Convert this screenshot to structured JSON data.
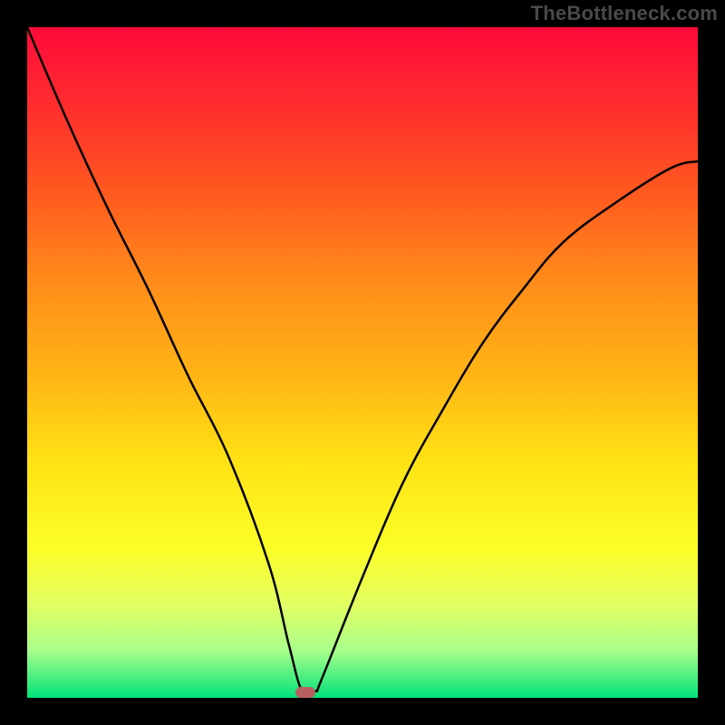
{
  "watermark": "TheBottleneck.com",
  "chart_data": {
    "type": "line",
    "title": "",
    "xlabel": "",
    "ylabel": "",
    "xlim": [
      0,
      100
    ],
    "ylim": [
      0,
      100
    ],
    "grid": false,
    "legend": false,
    "series": [
      {
        "name": "bottleneck-curve",
        "x": [
          0,
          6,
          12,
          18,
          24,
          30,
          36,
          39,
          41,
          43,
          44,
          50,
          56,
          62,
          68,
          74,
          80,
          88,
          96,
          100
        ],
        "y": [
          100,
          86,
          73,
          61,
          48,
          36,
          20,
          8,
          1,
          1,
          3,
          18,
          32,
          43,
          53,
          61,
          68,
          74,
          79,
          80
        ]
      }
    ],
    "marker": {
      "x": 41.5,
      "y": 0.8
    },
    "background": "rainbow-vertical-gradient",
    "colors": {
      "curve": "#000000",
      "gradient_top": "#ff0a3a",
      "gradient_bottom": "#00e37a",
      "frame": "#000000",
      "marker": "#b86060"
    }
  }
}
